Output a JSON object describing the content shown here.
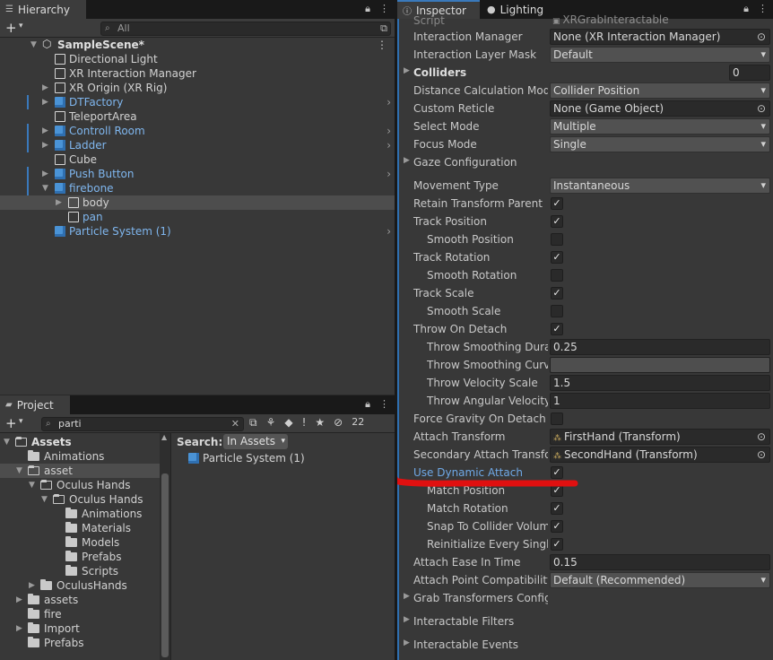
{
  "hierarchy": {
    "tab": "Hierarchy",
    "search_placeholder": "All",
    "scene": "SampleScene*",
    "items": [
      {
        "label": "Directional Light",
        "indent": 1,
        "prefab": false,
        "arrow": "",
        "marker": false,
        "chev": false
      },
      {
        "label": "XR Interaction Manager",
        "indent": 1,
        "prefab": false,
        "arrow": "",
        "marker": false,
        "chev": false
      },
      {
        "label": "XR Origin (XR Rig)",
        "indent": 1,
        "prefab": false,
        "arrow": "▶",
        "marker": false,
        "chev": false
      },
      {
        "label": "DTFactory",
        "indent": 1,
        "prefab": true,
        "arrow": "▶",
        "marker": true,
        "chev": true
      },
      {
        "label": "TeleportArea",
        "indent": 1,
        "prefab": false,
        "arrow": "",
        "marker": false,
        "chev": false
      },
      {
        "label": "Controll Room",
        "indent": 1,
        "prefab": true,
        "arrow": "▶",
        "marker": true,
        "chev": true
      },
      {
        "label": "Ladder",
        "indent": 1,
        "prefab": true,
        "arrow": "▶",
        "marker": true,
        "chev": true
      },
      {
        "label": "Cube",
        "indent": 1,
        "prefab": false,
        "arrow": "",
        "marker": false,
        "chev": false
      },
      {
        "label": "Push Button",
        "indent": 1,
        "prefab": true,
        "arrow": "▶",
        "marker": true,
        "chev": true
      },
      {
        "label": "firebone",
        "indent": 1,
        "prefab": true,
        "arrow": "▼",
        "marker": true,
        "chev": false
      },
      {
        "label": "body",
        "indent": 2,
        "prefab": false,
        "arrow": "▶",
        "marker": false,
        "chev": false,
        "selected": true
      },
      {
        "label": "pan",
        "indent": 2,
        "prefab": false,
        "arrow": "",
        "marker": false,
        "chev": false,
        "bluetext": true
      },
      {
        "label": "Particle System (1)",
        "indent": 1,
        "prefab": true,
        "arrow": "",
        "marker": false,
        "chev": true
      }
    ]
  },
  "project": {
    "tab": "Project",
    "search_value": "parti",
    "badge_count": "22",
    "search_label": "Search:",
    "search_scope": "In Assets",
    "result": "Particle System (1)",
    "tree": [
      {
        "label": "Assets",
        "indent": 0,
        "arrow": "▼",
        "open": true,
        "bold": true
      },
      {
        "label": "Animations",
        "indent": 1,
        "arrow": "",
        "open": false
      },
      {
        "label": "asset",
        "indent": 1,
        "arrow": "▼",
        "open": true,
        "selected": true
      },
      {
        "label": "Oculus Hands",
        "indent": 2,
        "arrow": "▼",
        "open": true
      },
      {
        "label": "Oculus Hands",
        "indent": 3,
        "arrow": "▼",
        "open": true
      },
      {
        "label": "Animations",
        "indent": 4,
        "arrow": "",
        "open": false
      },
      {
        "label": "Materials",
        "indent": 4,
        "arrow": "",
        "open": false
      },
      {
        "label": "Models",
        "indent": 4,
        "arrow": "",
        "open": false
      },
      {
        "label": "Prefabs",
        "indent": 4,
        "arrow": "",
        "open": false
      },
      {
        "label": "Scripts",
        "indent": 4,
        "arrow": "",
        "open": false
      },
      {
        "label": "OculusHands",
        "indent": 2,
        "arrow": "▶",
        "open": false
      },
      {
        "label": "assets",
        "indent": 1,
        "arrow": "▶",
        "open": false
      },
      {
        "label": "fire",
        "indent": 1,
        "arrow": "",
        "open": false
      },
      {
        "label": "Import",
        "indent": 1,
        "arrow": "▶",
        "open": false
      },
      {
        "label": "Prefabs",
        "indent": 1,
        "arrow": "",
        "open": false
      }
    ]
  },
  "inspector": {
    "tab": "Inspector",
    "tab2": "Lighting",
    "script_label": "Script",
    "script_value": "XRGrabInteractable",
    "fields": [
      {
        "label": "Interaction Manager",
        "type": "obj",
        "value": "None (XR Interaction Manager)"
      },
      {
        "label": "Interaction Layer Mask",
        "type": "drop",
        "value": "Default"
      },
      {
        "label": "Colliders",
        "type": "num-small",
        "value": "0",
        "fold": "▶",
        "bold": true
      },
      {
        "label": "Distance Calculation Mode",
        "type": "drop",
        "value": "Collider Position"
      },
      {
        "label": "Custom Reticle",
        "type": "obj",
        "value": "None (Game Object)"
      },
      {
        "label": "Select Mode",
        "type": "drop",
        "value": "Multiple"
      },
      {
        "label": "Focus Mode",
        "type": "drop",
        "value": "Single"
      },
      {
        "label": "Gaze Configuration",
        "type": "none",
        "value": "",
        "fold": "▶"
      },
      {
        "label": "Movement Type",
        "type": "drop",
        "value": "Instantaneous",
        "gap": true
      },
      {
        "label": "Retain Transform Parent",
        "type": "chk",
        "value": "✓"
      },
      {
        "label": "Track Position",
        "type": "chk",
        "value": "✓"
      },
      {
        "label": "Smooth Position",
        "type": "chk",
        "value": "",
        "indent": true
      },
      {
        "label": "Track Rotation",
        "type": "chk",
        "value": "✓"
      },
      {
        "label": "Smooth Rotation",
        "type": "chk",
        "value": "",
        "indent": true
      },
      {
        "label": "Track Scale",
        "type": "chk",
        "value": "✓"
      },
      {
        "label": "Smooth Scale",
        "type": "chk",
        "value": "",
        "indent": true
      },
      {
        "label": "Throw On Detach",
        "type": "chk",
        "value": "✓"
      },
      {
        "label": "Throw Smoothing Duration",
        "type": "text",
        "value": "0.25",
        "indent": true
      },
      {
        "label": "Throw Smoothing Curve",
        "type": "empty",
        "value": "",
        "indent": true
      },
      {
        "label": "Throw Velocity Scale",
        "type": "text",
        "value": "1.5",
        "indent": true
      },
      {
        "label": "Throw Angular Velocity",
        "type": "text",
        "value": "1",
        "indent": true
      },
      {
        "label": "Force Gravity On Detach",
        "type": "chk",
        "value": ""
      },
      {
        "label": "Attach Transform",
        "type": "obj",
        "value": "FirstHand (Transform)",
        "icon": true
      },
      {
        "label": "Secondary Attach Transform",
        "type": "obj",
        "value": "SecondHand (Transform)",
        "icon": true
      },
      {
        "label": "Use Dynamic Attach",
        "type": "chk",
        "value": "✓",
        "highlight": true
      },
      {
        "label": "Match Position",
        "type": "chk",
        "value": "✓",
        "indent": true
      },
      {
        "label": "Match Rotation",
        "type": "chk",
        "value": "✓",
        "indent": true
      },
      {
        "label": "Snap To Collider Volume",
        "type": "chk",
        "value": "✓",
        "indent": true
      },
      {
        "label": "Reinitialize Every Single Grab",
        "type": "chk",
        "value": "✓",
        "indent": true
      },
      {
        "label": "Attach Ease In Time",
        "type": "text",
        "value": "0.15"
      },
      {
        "label": "Attach Point Compatibility",
        "type": "drop",
        "value": "Default (Recommended)"
      },
      {
        "label": "Grab Transformers Configuration",
        "type": "none",
        "value": "",
        "fold": "▶"
      },
      {
        "label": "Interactable Filters",
        "type": "none",
        "value": "",
        "fold": "▶",
        "gap": true
      },
      {
        "label": "Interactable Events",
        "type": "none",
        "value": "",
        "fold": "▶",
        "gap": true
      }
    ]
  },
  "colors": {
    "accent": "#3a79bb",
    "prefab_text": "#7fb6ee",
    "annotation_red": "#e01010"
  }
}
